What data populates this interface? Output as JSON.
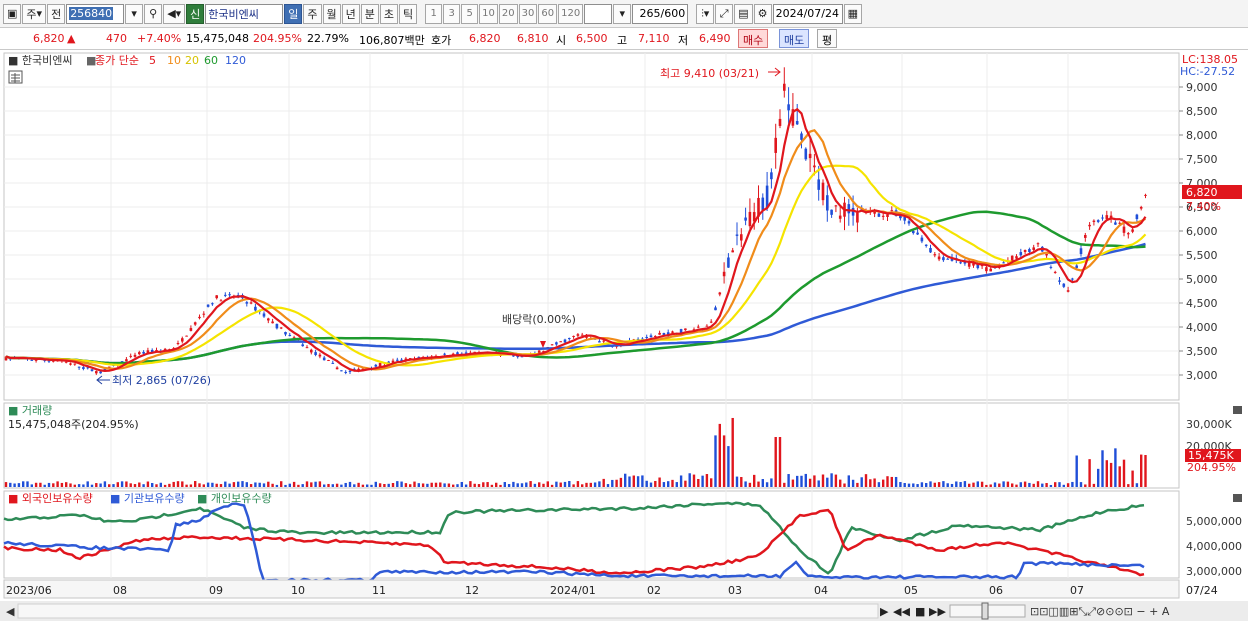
{
  "toolbar": {
    "market_mode": "주",
    "market_arrow": "▾",
    "prev_label": "전",
    "code": "256840",
    "name_badge": "신",
    "name": "한국비엔씨",
    "periods": [
      "일",
      "주",
      "월",
      "년",
      "분",
      "초",
      "틱"
    ],
    "period_selected": "일",
    "intervals": [
      "1",
      "3",
      "5",
      "10",
      "20",
      "30",
      "60",
      "120"
    ],
    "count_value": "265",
    "count_total": "/600",
    "date": "2024/07/24"
  },
  "quote": {
    "price": "6,820",
    "change_arrow": "▲",
    "change": "470",
    "change_pct": "+7.40%",
    "volume": "15,475,048",
    "volume_ratio": "204.95%",
    "turnover": "22.79%",
    "amount": "106,807백만",
    "ask_label": "호가",
    "ask": "6,820",
    "bid": "6,810",
    "open_label": "시",
    "open": "6,500",
    "high_label": "고",
    "high": "7,110",
    "low_label": "저",
    "low": "6,490",
    "buy_label": "매수",
    "sell_label": "매도",
    "avg_label": "평"
  },
  "colors": {
    "up": "#e0161d",
    "down": "#1f4ed8",
    "ma5": "#e0161d",
    "ma10": "#f08c1a",
    "ma20": "#f5e400",
    "ma60": "#1e9a2e",
    "ma120": "#2f5ad6",
    "foreign": "#e0161d",
    "institution": "#2f5ad6",
    "individual": "#2e8b57"
  },
  "price_panel": {
    "stock_name": "한국비엔씨",
    "legend_prefix": "종가 단순",
    "ma_periods": [
      "5",
      "10",
      "20",
      "60",
      "120"
    ],
    "lc": "LC:138.05",
    "hc": "HC:-27.52",
    "y_ticks": [
      "9,000",
      "8,500",
      "8,000",
      "7,500",
      "7,000",
      "6,500",
      "6,000",
      "5,500",
      "5,000",
      "4,500",
      "4,000",
      "3,500",
      "3,000"
    ],
    "current_price_tag": "6,820",
    "current_pct_tag": "7.40%",
    "annotation_high": "최고 9,410 (03/21)",
    "annotation_low": "최저 2,865 (07/26)",
    "annotation_dividend": "배당락(0.00%)"
  },
  "volume_panel": {
    "title": "거래량",
    "readout": "15,475,048주(204.95%)",
    "y_ticks": [
      "30,000K",
      "20,000K"
    ],
    "current_tag": "15,475K",
    "current_pct": "204.95%"
  },
  "holdings_panel": {
    "legend": [
      "외국인보유수량",
      "기관보유수량",
      "개인보유수량"
    ],
    "y_ticks": [
      "5,000,000",
      "4,000,000",
      "3,000,000"
    ]
  },
  "x_axis": {
    "labels": [
      "2023/06",
      "08",
      "09",
      "10",
      "11",
      "12",
      "2024/01",
      "02",
      "03",
      "04",
      "05",
      "06",
      "07",
      "07/24"
    ]
  }
}
